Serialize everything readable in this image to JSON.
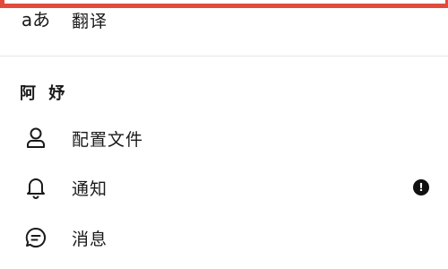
{
  "menu": {
    "translate": {
      "icon": "translate-icon",
      "icon_glyph": "aあ",
      "label": "翻译"
    },
    "section_title": "阿 妤",
    "profile": {
      "icon": "person-icon",
      "label": "配置文件"
    },
    "notifications": {
      "icon": "bell-icon",
      "label": "通知",
      "badge": "!"
    },
    "messages": {
      "icon": "chat-bubble-icon",
      "label": "消息"
    }
  },
  "colors": {
    "highlight": "#e14b3c",
    "text": "#1a1a1a",
    "badge": "#111111",
    "divider": "#e6e6e6"
  }
}
